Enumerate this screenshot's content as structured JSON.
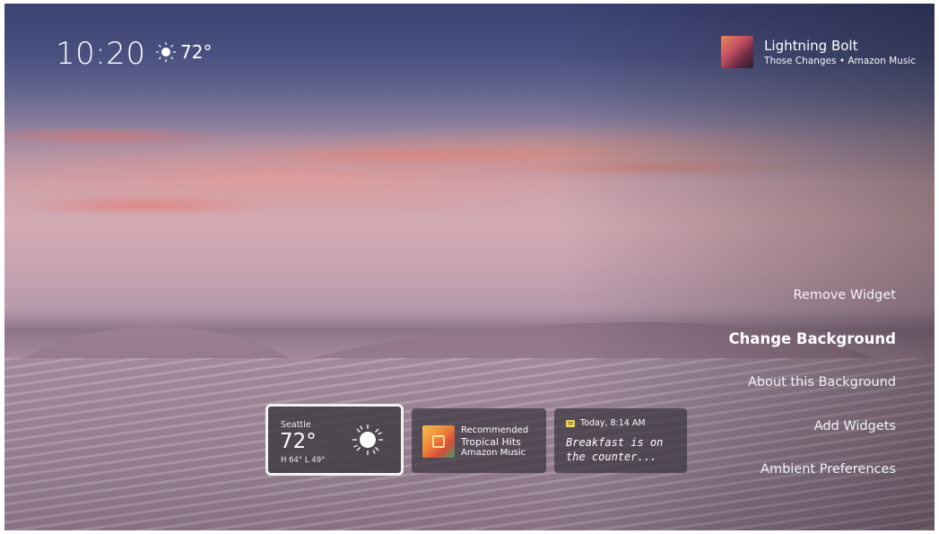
{
  "clock": {
    "time": "10:20"
  },
  "header_weather": {
    "icon": "sun-icon",
    "temperature": "72°"
  },
  "now_playing": {
    "title": "Lightning Bolt",
    "subtitle": "Those Changes • Amazon Music"
  },
  "menu": {
    "items": [
      {
        "label": "Remove Widget",
        "active": false
      },
      {
        "label": "Change Background",
        "active": true
      },
      {
        "label": "About this Background",
        "active": false
      },
      {
        "label": "Add Widgets",
        "active": false
      },
      {
        "label": "Ambient Preferences",
        "active": false
      }
    ]
  },
  "widgets": {
    "weather": {
      "city": "Seattle",
      "temperature": "72°",
      "high_low": "H 64° L 49°",
      "icon": "sun-icon"
    },
    "music": {
      "label": "Recommended",
      "title": "Tropical Hits",
      "source": "Amazon Music"
    },
    "note": {
      "timestamp": "Today, 8:14 AM",
      "text": "Breakfast is on the counter..."
    }
  },
  "colors": {
    "text": "#ffffff",
    "focus_border": "#f2f2f2",
    "note_icon": "#f2d257"
  }
}
